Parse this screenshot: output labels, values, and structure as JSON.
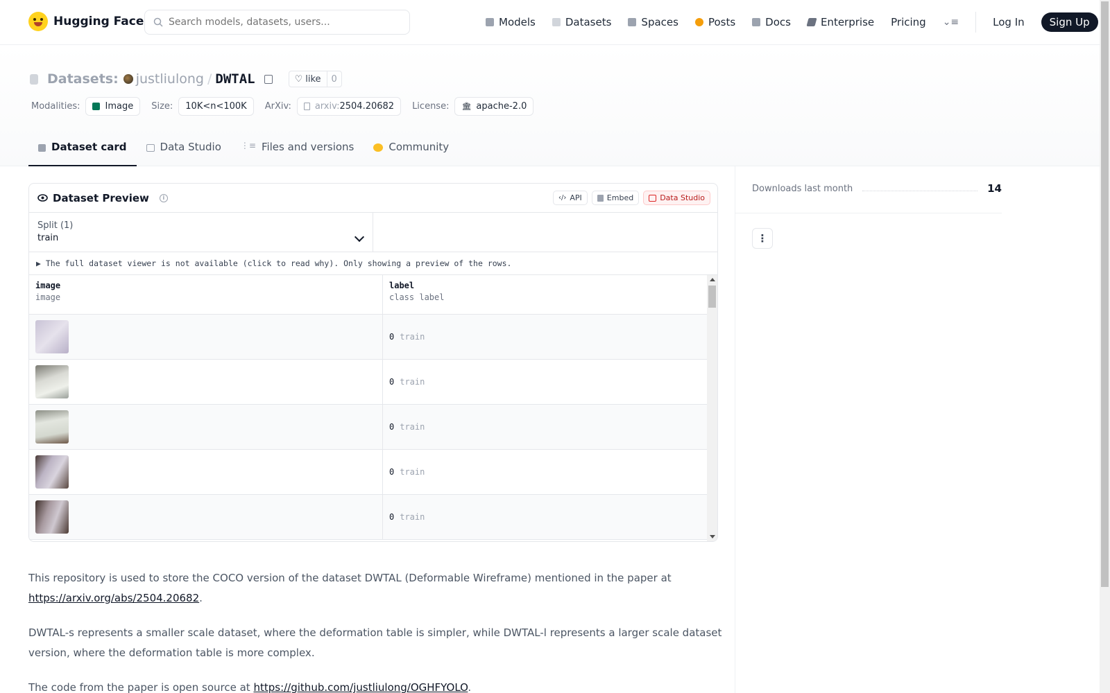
{
  "nav": {
    "brand": "Hugging Face",
    "search_placeholder": "Search models, datasets, users...",
    "links": [
      {
        "label": "Models",
        "icon": "models-icon",
        "color": "#9ca3af"
      },
      {
        "label": "Datasets",
        "icon": "datasets-icon",
        "color": "#d1d5db"
      },
      {
        "label": "Spaces",
        "icon": "spaces-icon",
        "color": "#9ca3af"
      },
      {
        "label": "Posts",
        "icon": "posts-icon",
        "color": "#f59e0b"
      },
      {
        "label": "Docs",
        "icon": "docs-icon",
        "color": "#9ca3af"
      },
      {
        "label": "Enterprise",
        "icon": "enterprise-icon",
        "color": "#6b7280"
      }
    ],
    "pricing": "Pricing",
    "login": "Log In",
    "signup": "Sign Up"
  },
  "header": {
    "section": "Datasets:",
    "owner": "justliulong",
    "separator": "/",
    "repo": "DWTAL",
    "like_label": "like",
    "like_count": "0",
    "tags": {
      "modalities_label": "Modalities:",
      "modality": "Image",
      "size_label": "Size:",
      "size": "10K<n<100K",
      "arxiv_label": "ArXiv:",
      "arxiv_prefix": "arxiv:",
      "arxiv_id": "2504.20682",
      "license_label": "License:",
      "license": "apache-2.0"
    },
    "tabs": [
      "Dataset card",
      "Data Studio",
      "Files and versions",
      "Community"
    ]
  },
  "preview": {
    "title": "Dataset Preview",
    "buttons": {
      "api": "API",
      "embed": "Embed",
      "studio": "Data Studio"
    },
    "split_label": "Split (1)",
    "split_value": "train",
    "notice": "▶ The full dataset viewer is not available (click to read why). Only showing a preview of the rows.",
    "columns": [
      {
        "name": "image",
        "type": "image"
      },
      {
        "name": "label",
        "type": "class label"
      }
    ],
    "rows": [
      {
        "label_value": "0",
        "label_name": "train"
      },
      {
        "label_value": "0",
        "label_name": "train"
      },
      {
        "label_value": "0",
        "label_name": "train"
      },
      {
        "label_value": "0",
        "label_name": "train"
      },
      {
        "label_value": "0",
        "label_name": "train"
      }
    ]
  },
  "sidebar": {
    "downloads_label": "Downloads last month",
    "downloads_value": "14"
  },
  "card": {
    "p1": "This repository is used to store the COCO version of the dataset DWTAL (Deformable Wireframe) mentioned in the paper at",
    "p1_link": "https://arxiv.org/abs/2504.20682",
    "p2": "DWTAL-s represents a smaller scale dataset, where the deformation table is simpler, while DWTAL-l represents a larger scale dataset version, where the deformation table is more complex.",
    "p3": "The code from the paper is open source at",
    "p3_link": "https://github.com/justliulong/OGHFYOLO"
  }
}
